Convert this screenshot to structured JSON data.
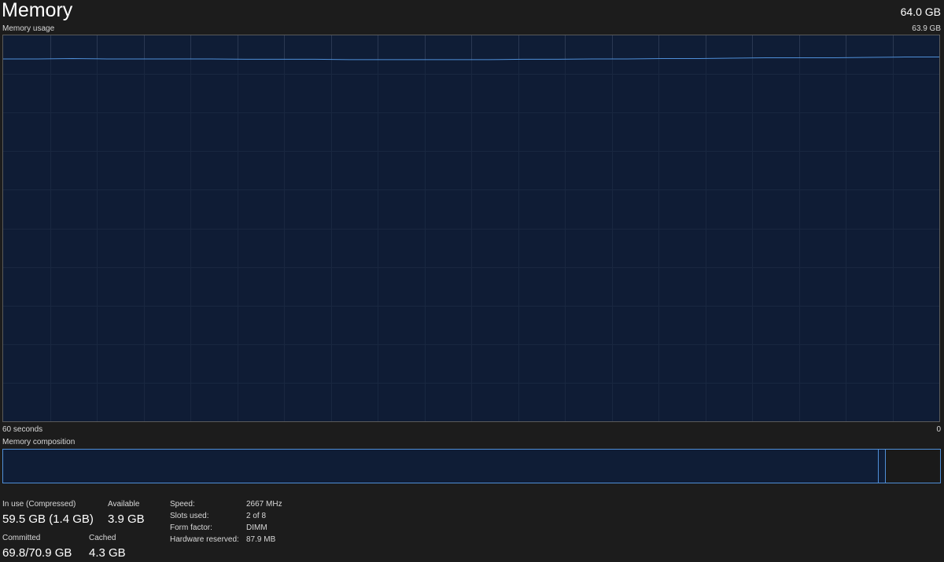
{
  "header": {
    "title": "Memory",
    "capacity": "64.0 GB"
  },
  "graph": {
    "label": "Memory usage",
    "max_label": "63.9 GB",
    "time_span_label": "60 seconds",
    "end_label": "0",
    "line_color": "#4f8fd8",
    "fill_color": "#0f1d36",
    "grid_color": "#2a3852",
    "usage_fraction_series": [
      0.939,
      0.939,
      0.94,
      0.939,
      0.939,
      0.939,
      0.939,
      0.938,
      0.938,
      0.938,
      0.937,
      0.937,
      0.937,
      0.937,
      0.937,
      0.938,
      0.938,
      0.939,
      0.939,
      0.94,
      0.94,
      0.941,
      0.942,
      0.942,
      0.942,
      0.943,
      0.944,
      0.944
    ]
  },
  "composition": {
    "label": "Memory composition"
  },
  "stats": {
    "in_use_label": "In use (Compressed)",
    "in_use_value": "59.5 GB (1.4 GB)",
    "available_label": "Available",
    "available_value": "3.9 GB",
    "committed_label": "Committed",
    "committed_value": "69.8/70.9 GB",
    "cached_label": "Cached",
    "cached_value": "4.3 GB"
  },
  "specs": {
    "speed_label": "Speed:",
    "speed_value": "2667 MHz",
    "slots_label": "Slots used:",
    "slots_value": "2 of 8",
    "form_label": "Form factor:",
    "form_value": "DIMM",
    "reserved_label": "Hardware reserved:",
    "reserved_value": "87.9 MB"
  }
}
